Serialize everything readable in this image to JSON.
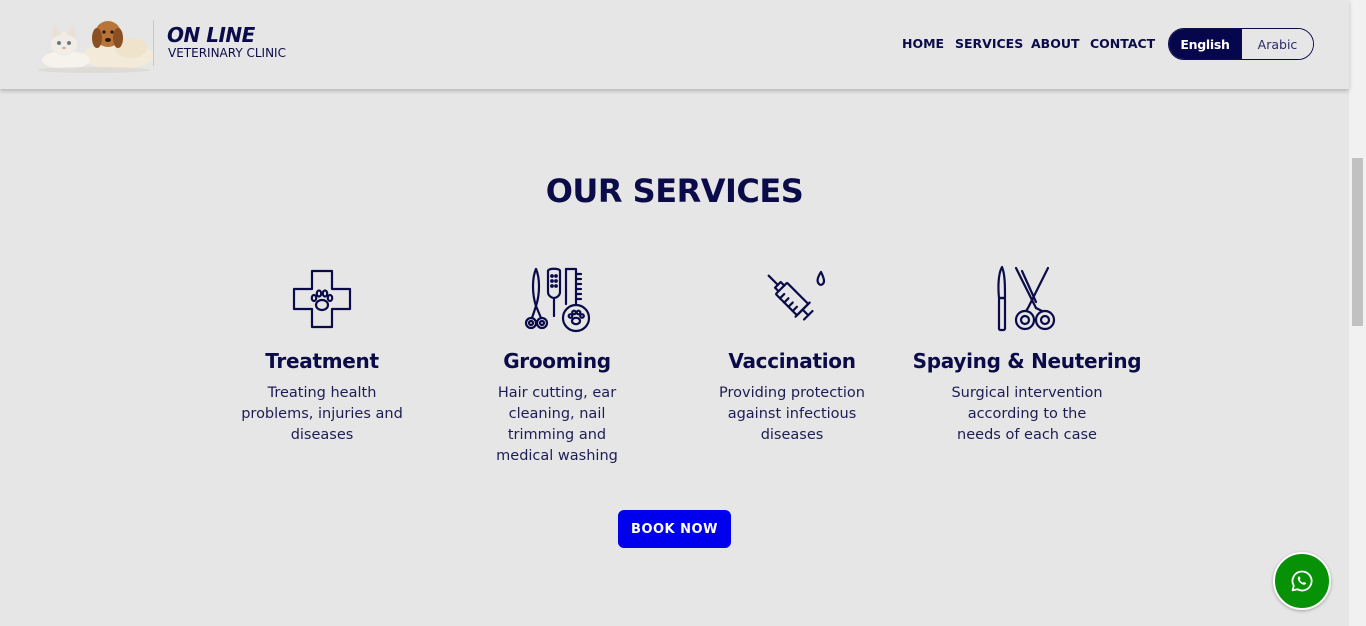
{
  "header": {
    "logo_icon": "cat-and-dog-logo",
    "brand_title": "ON LINE",
    "brand_subtitle": "VETERINARY CLINIC",
    "nav": [
      {
        "label": "HOME"
      },
      {
        "label": "SERVICES"
      },
      {
        "label": "ABOUT"
      },
      {
        "label": "CONTACT"
      }
    ],
    "language": {
      "options": [
        "English",
        "Arabic"
      ],
      "selected": "English"
    }
  },
  "main": {
    "title": "OUR SERVICES",
    "services": [
      {
        "icon": "medical-cross-paw-icon",
        "title": "Treatment",
        "lines": [
          "Treating health",
          "problems, injuries and",
          "diseases"
        ]
      },
      {
        "icon": "grooming-tools-icon",
        "title": "Grooming",
        "lines": [
          "Hair cutting, ear",
          "cleaning, nail",
          "trimming and",
          "medical washing"
        ]
      },
      {
        "icon": "syringe-icon",
        "title": "Vaccination",
        "lines": [
          "Providing protection",
          "against infectious",
          "diseases"
        ]
      },
      {
        "icon": "surgical-scissors-icon",
        "title": "Spaying & Neutering",
        "lines": [
          "Surgical intervention",
          "according to the",
          "needs of each case"
        ]
      }
    ],
    "cta_label": "BOOK NOW"
  },
  "floating": {
    "whatsapp_icon": "whatsapp-icon"
  },
  "colors": {
    "primary_navy": "#0b0b4a",
    "cta_blue": "#0000ee",
    "whatsapp_green": "#079107",
    "background": "#e6e6e6"
  }
}
